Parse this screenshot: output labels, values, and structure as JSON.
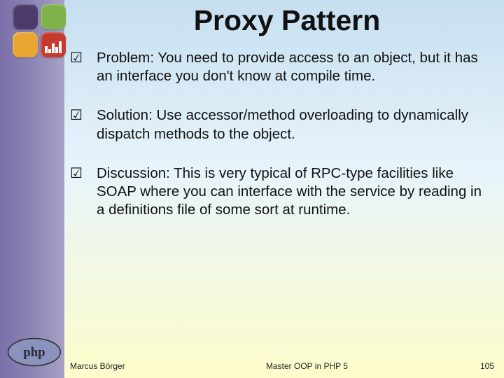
{
  "title": "Proxy Pattern",
  "bullets": [
    {
      "text": "Problem: You need to provide access to an object, but it has an interface you don't know at compile time."
    },
    {
      "text": "Solution: Use accessor/method overloading to dynamically dispatch methods to the object."
    },
    {
      "text": "Discussion: This is very typical of RPC-type facilities like SOAP where you can interface with the service by reading in a definitions file of some sort at runtime."
    }
  ],
  "footer": {
    "author": "Marcus Börger",
    "title": "Master OOP in PHP 5",
    "page": "105"
  },
  "icons": {
    "check": "☑"
  }
}
